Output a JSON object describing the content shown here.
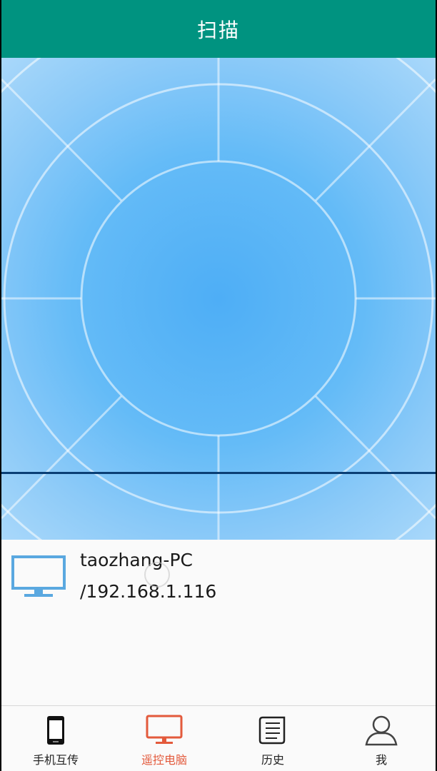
{
  "header": {
    "title": "扫描"
  },
  "device": {
    "icon": "monitor-icon",
    "name": "taozhang-PC",
    "ip": "/192.168.1.116"
  },
  "tabs": [
    {
      "label": "手机互传",
      "icon": "phone-icon",
      "active": false
    },
    {
      "label": "遥控电脑",
      "icon": "monitor-icon",
      "active": true
    },
    {
      "label": "历史",
      "icon": "scroll-icon",
      "active": false
    },
    {
      "label": "我",
      "icon": "user-icon",
      "active": false
    }
  ],
  "colors": {
    "header_bg": "#009380",
    "active_tab": "#e35a3c",
    "monitor_icon": "#5aa8e0",
    "scan_line": "#0a3f75"
  }
}
